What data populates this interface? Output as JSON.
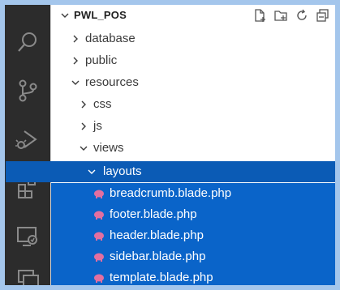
{
  "explorer": {
    "root_title": "PWL_POS",
    "tree": [
      {
        "label": "database",
        "expanded": false
      },
      {
        "label": "public",
        "expanded": false
      },
      {
        "label": "resources",
        "expanded": true
      },
      {
        "label": "css",
        "expanded": false
      },
      {
        "label": "js",
        "expanded": false
      },
      {
        "label": "views",
        "expanded": true
      },
      {
        "label": "layouts",
        "expanded": true
      }
    ],
    "files": [
      "breadcrumb.blade.php",
      "footer.blade.php",
      "header.blade.php",
      "sidebar.blade.php",
      "template.blade.php"
    ]
  },
  "activity_bar": {
    "icons": [
      "search-icon",
      "source-control-icon",
      "run-debug-icon",
      "extensions-icon",
      "remote-explorer-icon",
      "extra-panel-icon"
    ]
  },
  "colors": {
    "selection": "#0a64c9",
    "folder_selected": "#0b5bb5",
    "blade_icon": "#e36fa0",
    "activity_bar_bg": "#2c2c2c"
  }
}
